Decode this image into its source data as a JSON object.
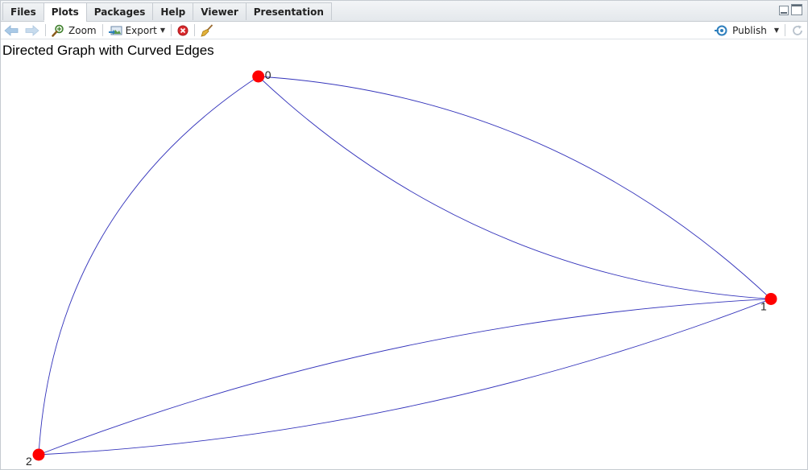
{
  "tabs": [
    {
      "label": "Files",
      "active": false
    },
    {
      "label": "Plots",
      "active": true
    },
    {
      "label": "Packages",
      "active": false
    },
    {
      "label": "Help",
      "active": false
    },
    {
      "label": "Viewer",
      "active": false
    },
    {
      "label": "Presentation",
      "active": false
    }
  ],
  "toolbar": {
    "back_icon": "arrow-left-icon",
    "forward_icon": "arrow-right-icon",
    "zoom_label": "Zoom",
    "export_label": "Export",
    "remove_icon": "remove-plot-icon",
    "clear_icon": "broom-icon",
    "publish_label": "Publish",
    "refresh_icon": "refresh-icon"
  },
  "colors": {
    "node": "#ff0000",
    "edge": "#3333bb",
    "accent": "#2e7fbd"
  },
  "chart_data": {
    "type": "network",
    "title": "Directed Graph with Curved Edges",
    "nodes": [
      {
        "id": "0",
        "label": "0",
        "x": 0.33,
        "y": 0.85
      },
      {
        "id": "1",
        "label": "1",
        "x": 0.96,
        "y": 0.35
      },
      {
        "id": "2",
        "label": "2",
        "x": 0.06,
        "y": 0.0
      }
    ],
    "edges": [
      {
        "from": "0",
        "to": "1",
        "curve": 0.18
      },
      {
        "from": "1",
        "to": "0",
        "curve": 0.18
      },
      {
        "from": "0",
        "to": "2",
        "curve": 0.25
      },
      {
        "from": "1",
        "to": "2",
        "curve": 0.08
      },
      {
        "from": "2",
        "to": "1",
        "curve": 0.08
      }
    ]
  }
}
